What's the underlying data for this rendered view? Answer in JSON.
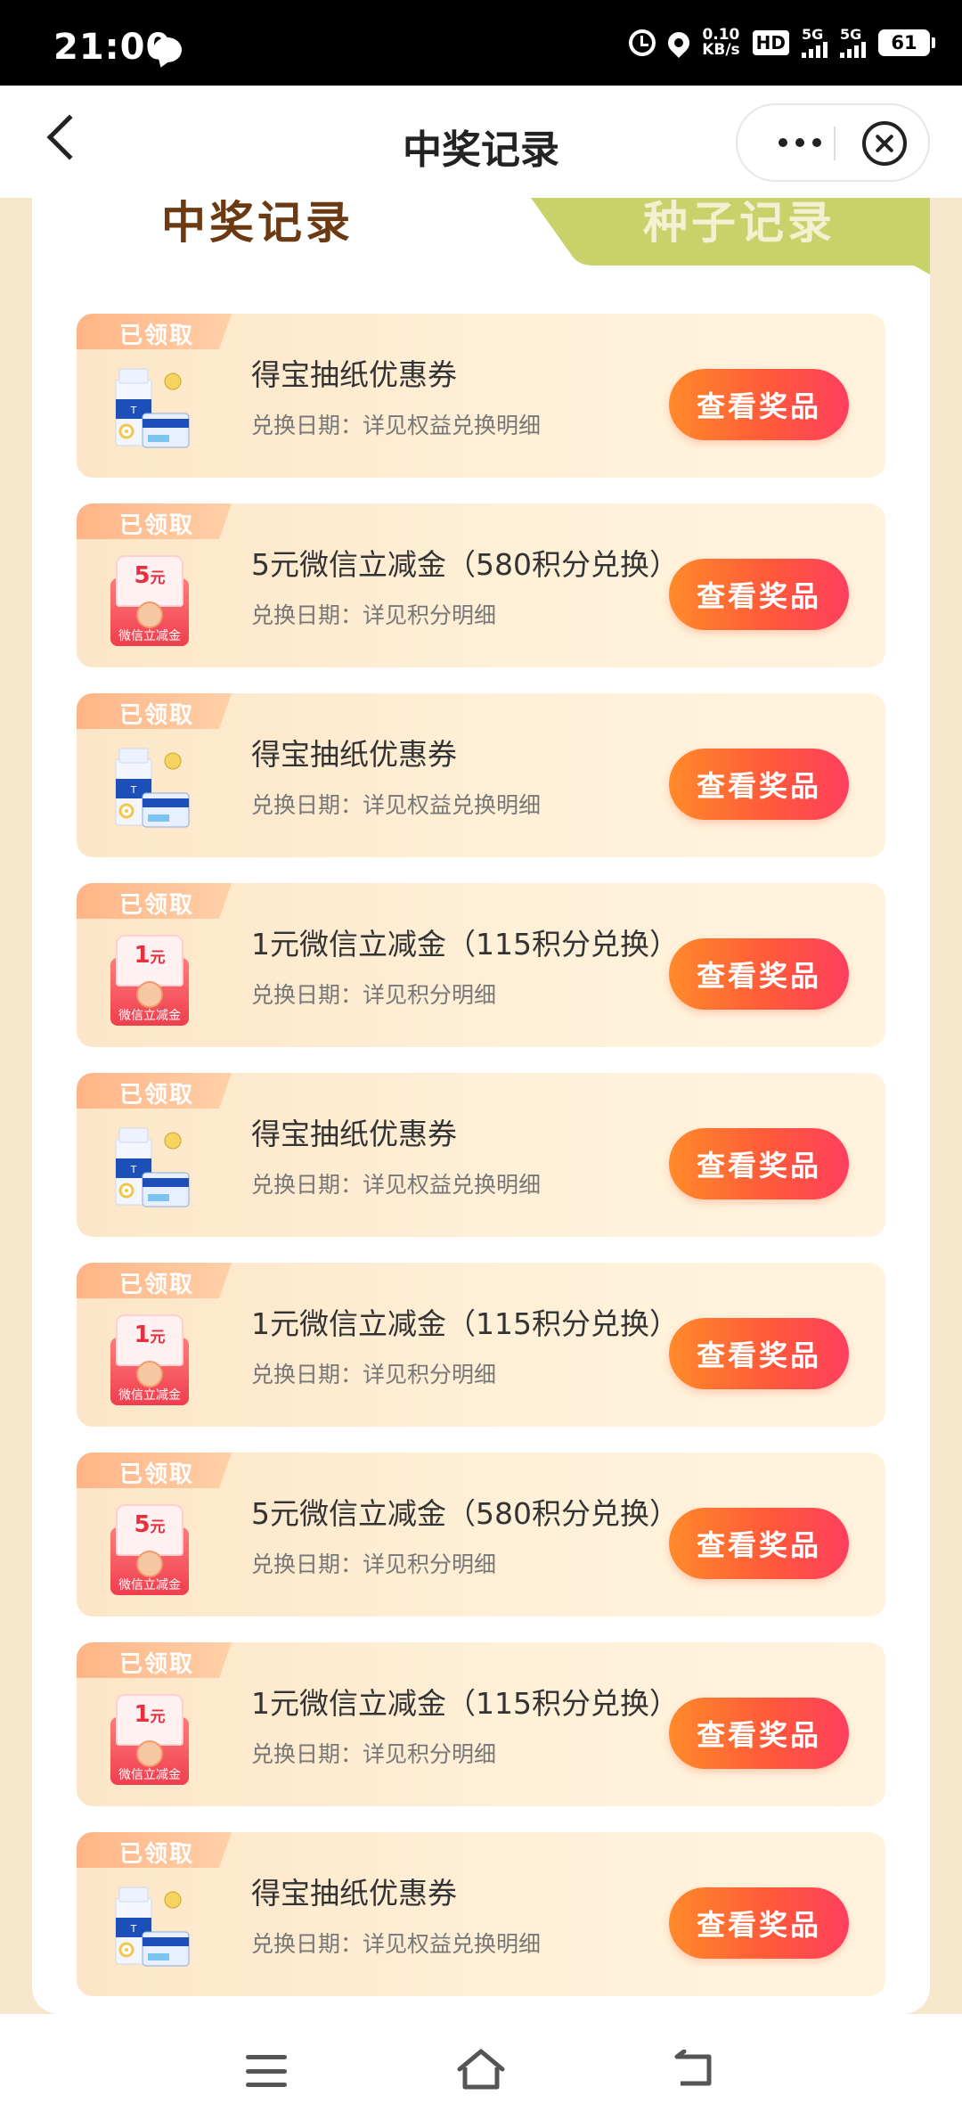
{
  "status_bar": {
    "time": "21:00",
    "net_speed_value": "0.10",
    "net_speed_unit": "KB/s",
    "hd_label": "HD",
    "sim1_label": "5G",
    "sim2_label": "5G",
    "battery": "61"
  },
  "nav": {
    "title": "中奖记录"
  },
  "tabs": [
    {
      "label": "中奖记录",
      "active": true
    },
    {
      "label": "种子记录",
      "active": false
    }
  ],
  "records": [
    {
      "tag": "已领取",
      "thumb": "tissue",
      "title": "得宝抽纸优惠券",
      "subtitle": "兑换日期：详见权益兑换明细",
      "button": "查看奖品"
    },
    {
      "tag": "已领取",
      "thumb": "envelope",
      "amount": "5",
      "amount_unit": "元",
      "env_text": "微信立减金",
      "title": "5元微信立减金（580积分兑换）",
      "subtitle": "兑换日期：详见积分明细",
      "button": "查看奖品"
    },
    {
      "tag": "已领取",
      "thumb": "tissue",
      "title": "得宝抽纸优惠券",
      "subtitle": "兑换日期：详见权益兑换明细",
      "button": "查看奖品"
    },
    {
      "tag": "已领取",
      "thumb": "envelope",
      "amount": "1",
      "amount_unit": "元",
      "env_text": "微信立减金",
      "title": "1元微信立减金（115积分兑换）",
      "subtitle": "兑换日期：详见积分明细",
      "button": "查看奖品"
    },
    {
      "tag": "已领取",
      "thumb": "tissue",
      "title": "得宝抽纸优惠券",
      "subtitle": "兑换日期：详见权益兑换明细",
      "button": "查看奖品"
    },
    {
      "tag": "已领取",
      "thumb": "envelope",
      "amount": "1",
      "amount_unit": "元",
      "env_text": "微信立减金",
      "title": "1元微信立减金（115积分兑换）",
      "subtitle": "兑换日期：详见积分明细",
      "button": "查看奖品"
    },
    {
      "tag": "已领取",
      "thumb": "envelope",
      "amount": "5",
      "amount_unit": "元",
      "env_text": "微信立减金",
      "title": "5元微信立减金（580积分兑换）",
      "subtitle": "兑换日期：详见积分明细",
      "button": "查看奖品"
    },
    {
      "tag": "已领取",
      "thumb": "envelope",
      "amount": "1",
      "amount_unit": "元",
      "env_text": "微信立减金",
      "title": "1元微信立减金（115积分兑换）",
      "subtitle": "兑换日期：详见积分明细",
      "button": "查看奖品"
    },
    {
      "tag": "已领取",
      "thumb": "tissue",
      "title": "得宝抽纸优惠券",
      "subtitle": "兑换日期：详见权益兑换明细",
      "button": "查看奖品"
    }
  ],
  "colors": {
    "page_bg": "#f5e6cc",
    "tab_active_text": "#6b3a12",
    "tab_inactive_bg": "#c8d26a",
    "button_start": "#ff8a2a",
    "button_end": "#ff3f5e",
    "tag_start": "#ffb486",
    "tag_end": "#ffd0a8"
  }
}
